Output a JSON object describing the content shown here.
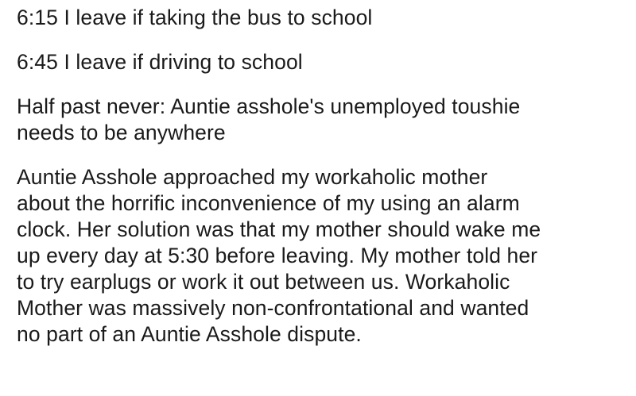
{
  "post": {
    "paragraphs": [
      {
        "lines": [
          "6:15 I leave if taking the bus to school"
        ]
      },
      {
        "lines": [
          "6:45 I leave if driving to school"
        ]
      },
      {
        "lines": [
          "Half past never: Auntie asshole's unemployed toushie",
          "needs to be anywhere"
        ]
      },
      {
        "lines": [
          "Auntie Asshole approached my workaholic mother",
          "about the horrific inconvenience of my using an alarm",
          "clock. Her solution was that my mother should wake me",
          "up every day at 5:30 before leaving. My mother told her",
          "to try earplugs or work it out between us. Workaholic",
          "Mother was massively non-confrontational and wanted",
          "no part of an Auntie Asshole dispute."
        ]
      }
    ]
  },
  "colors": {
    "text": "#1a1a1a",
    "background": "#ffffff"
  }
}
